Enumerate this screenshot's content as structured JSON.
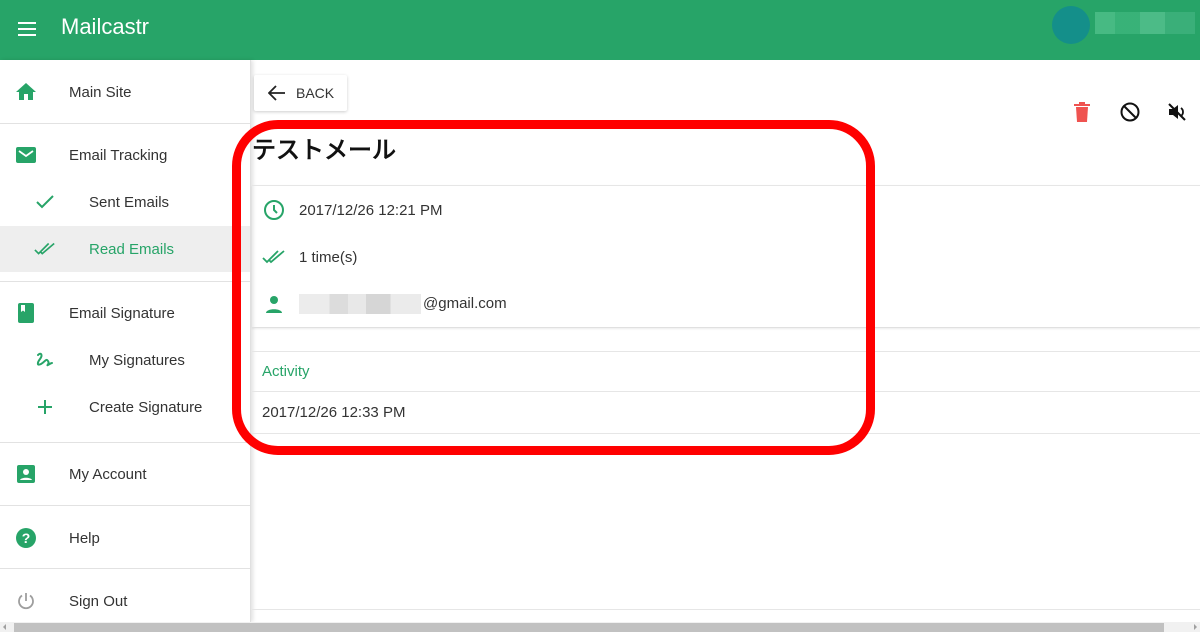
{
  "app": {
    "title": "Mailcastr",
    "brand_color": "#27a468"
  },
  "sidebar": {
    "items": [
      {
        "label": "Main Site",
        "icon": "home-icon"
      },
      {
        "label": "Email Tracking",
        "icon": "mail-icon"
      },
      {
        "label": "Sent Emails",
        "icon": "check-icon"
      },
      {
        "label": "Read Emails",
        "icon": "double-check-icon",
        "active": true
      },
      {
        "label": "Email Signature",
        "icon": "book-icon"
      },
      {
        "label": "My Signatures",
        "icon": "signature-icon"
      },
      {
        "label": "Create Signature",
        "icon": "plus-icon"
      },
      {
        "label": "My Account",
        "icon": "account-box-icon"
      },
      {
        "label": "Help",
        "icon": "help-icon"
      },
      {
        "label": "Sign Out",
        "icon": "power-icon"
      }
    ]
  },
  "toolbar": {
    "back_label": "BACK",
    "actions": [
      "delete-icon",
      "block-icon",
      "mute-icon"
    ]
  },
  "email": {
    "subject": "テストメール",
    "sent_at": "2017/12/26 12:21 PM",
    "read_count": "1 time(s)",
    "recipient_domain": "@gmail.com"
  },
  "activity": {
    "heading": "Activity",
    "entries": [
      "2017/12/26 12:33 PM"
    ]
  }
}
